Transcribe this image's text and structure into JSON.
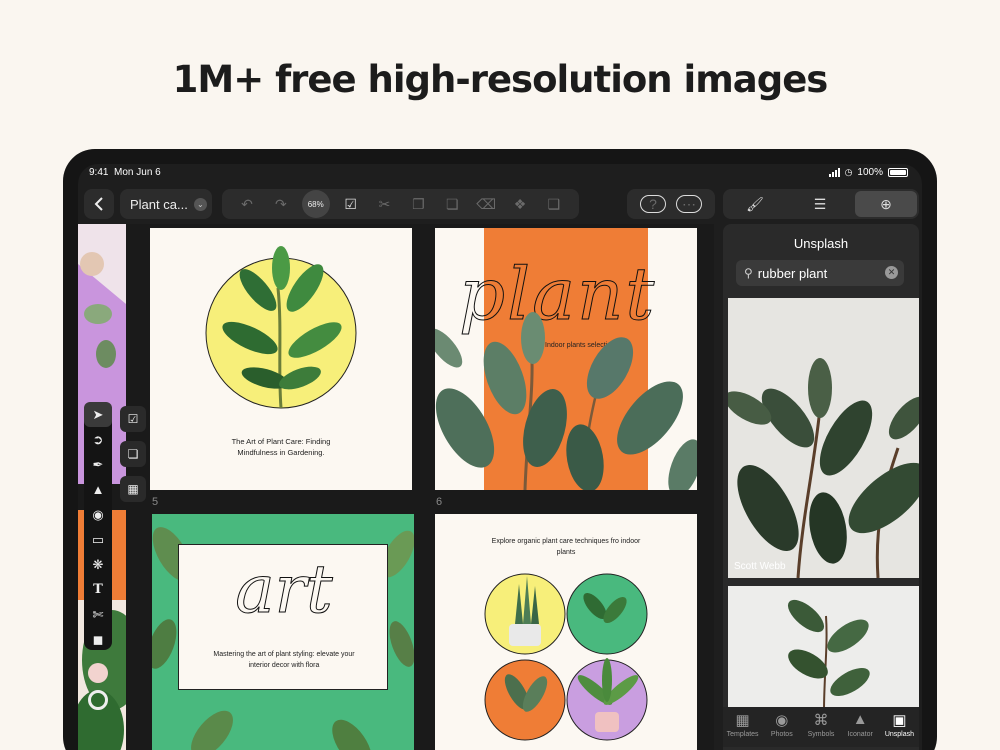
{
  "headline": "1M+ free high-resolution images",
  "status": {
    "time": "9:41",
    "date": "Mon Jun 6",
    "battery": "100%"
  },
  "toolbar": {
    "doc_title": "Plant ca...",
    "zoom": "68%"
  },
  "pages": {
    "p1_caption": "The Art of Plant Care: Finding Mindfulness in Gardening.",
    "p2_word": "plant",
    "p2_sub": "Indoor plants selection",
    "num5": "5",
    "num6": "6",
    "p3_word": "art",
    "p3_caption": "Mastering the art of plant styling: elevate your interior decor with flora",
    "p4_caption": "Explore organic plant care techniques fro indoor plants"
  },
  "panel": {
    "title": "Unsplash",
    "search_value": "rubber plant",
    "photo1_credit": "Scott Webb"
  },
  "dock": [
    {
      "label": "Templates",
      "icon": "templates-icon"
    },
    {
      "label": "Photos",
      "icon": "camera-icon"
    },
    {
      "label": "Symbols",
      "icon": "command-icon"
    },
    {
      "label": "Iconator",
      "icon": "rocket-icon"
    },
    {
      "label": "Unsplash",
      "icon": "unsplash-icon"
    }
  ],
  "colors": {
    "accent_yellow": "#f7ef7a",
    "accent_orange": "#ef7d36",
    "accent_green": "#49b97e",
    "accent_purple": "#c99ee0"
  }
}
